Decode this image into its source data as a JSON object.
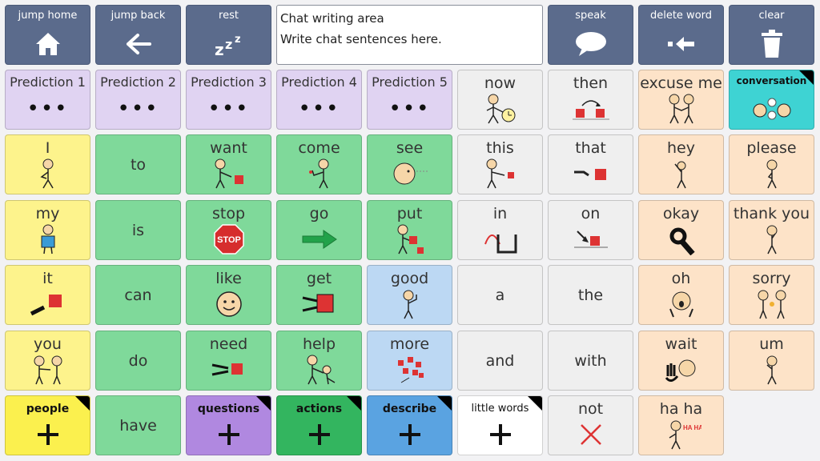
{
  "toolbar": {
    "jump_home": "jump home",
    "jump_back": "jump back",
    "rest": "rest",
    "speak": "speak",
    "delete_word": "delete word",
    "clear": "clear"
  },
  "chat": {
    "title": "Chat writing area",
    "placeholder": "Write chat sentences here."
  },
  "predictions": [
    "Prediction 1",
    "Prediction 2",
    "Prediction 3",
    "Prediction 4",
    "Prediction 5"
  ],
  "words": {
    "now": "now",
    "then": "then",
    "excuse_me": "excuse me",
    "conversation": "conversation",
    "i": "I",
    "to": "to",
    "want": "want",
    "come": "come",
    "see": "see",
    "this": "this",
    "that": "that",
    "hey": "hey",
    "please": "please",
    "my": "my",
    "is": "is",
    "stop": "stop",
    "go": "go",
    "put": "put",
    "in": "in",
    "on": "on",
    "okay": "okay",
    "thank_you": "thank you",
    "it": "it",
    "can": "can",
    "like": "like",
    "get": "get",
    "good": "good",
    "a": "a",
    "the": "the",
    "oh": "oh",
    "sorry": "sorry",
    "you": "you",
    "do": "do",
    "need": "need",
    "help": "help",
    "more": "more",
    "and": "and",
    "with": "with",
    "wait": "wait",
    "um": "um",
    "people": "people",
    "have": "have",
    "questions": "questions",
    "actions": "actions",
    "describe": "describe",
    "little_words": "little words",
    "not": "not",
    "ha_ha": "ha ha"
  },
  "icons": {
    "stop_sign": "STOP",
    "ha_sign": "HA HA"
  },
  "colors": {
    "toolbar": "#5b6b8c",
    "yellow": "#fdf38c",
    "green": "#7fd99a",
    "gray": "#efefef",
    "peach": "#fde3c8",
    "purple": "#e0d3f2",
    "blue": "#bcd8f3",
    "teal": "#3ed3d3"
  }
}
